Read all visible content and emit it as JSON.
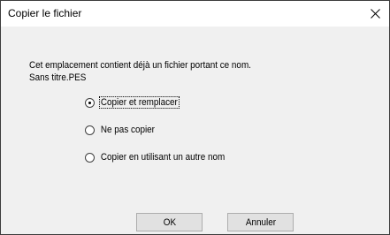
{
  "window": {
    "title": "Copier le fichier",
    "close_icon": "close-icon"
  },
  "message": {
    "line1": "Cet emplacement contient déjà un fichier portant ce nom.",
    "line2": "Sans titre.PES"
  },
  "options": [
    {
      "label": "Copier et remplacer",
      "checked": true
    },
    {
      "label": "Ne pas copier",
      "checked": false
    },
    {
      "label": "Copier en utilisant un autre nom",
      "checked": false
    }
  ],
  "buttons": {
    "ok_label": "OK",
    "cancel_label": "Annuler"
  }
}
